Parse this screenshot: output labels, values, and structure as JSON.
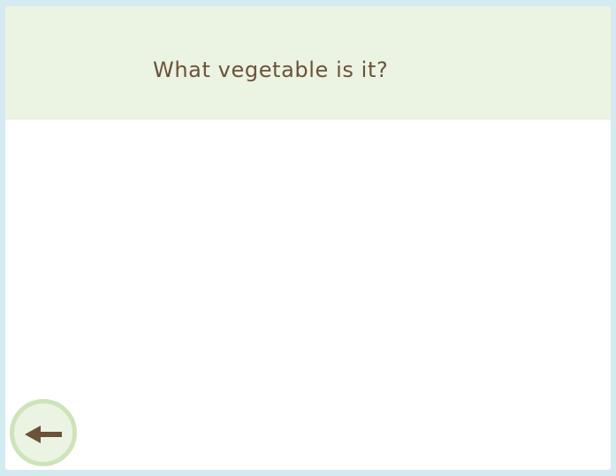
{
  "header": {
    "question": "What vegetable is it?"
  },
  "controls": {
    "back_icon": "arrow-left-icon"
  },
  "colors": {
    "page_background": "#d4eaf1",
    "header_background": "#ebf3e2",
    "text": "#6b5239",
    "button_ring": "#cde4b9",
    "button_fill": "#ebf3e2"
  }
}
